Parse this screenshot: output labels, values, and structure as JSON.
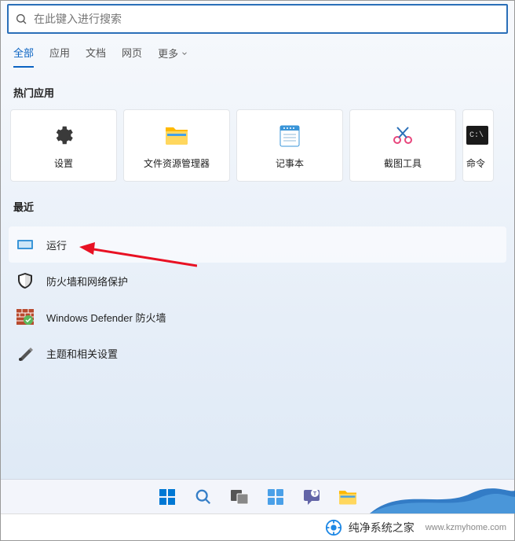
{
  "search": {
    "placeholder": "在此键入进行搜索"
  },
  "tabs": {
    "items": [
      {
        "label": "全部",
        "active": true
      },
      {
        "label": "应用"
      },
      {
        "label": "文档"
      },
      {
        "label": "网页"
      },
      {
        "label": "更多"
      }
    ]
  },
  "top_apps": {
    "title": "热门应用",
    "items": [
      {
        "label": "设置",
        "icon": "settings-icon"
      },
      {
        "label": "文件资源管理器",
        "icon": "file-explorer-icon"
      },
      {
        "label": "记事本",
        "icon": "notepad-icon"
      },
      {
        "label": "截图工具",
        "icon": "snipping-tool-icon"
      },
      {
        "label": "命令",
        "icon": "terminal-icon"
      }
    ]
  },
  "recent": {
    "title": "最近",
    "items": [
      {
        "label": "运行",
        "icon": "run-icon",
        "hover": true
      },
      {
        "label": "防火墙和网络保护",
        "icon": "shield-icon"
      },
      {
        "label": "Windows Defender 防火墙",
        "icon": "firewall-brick-icon"
      },
      {
        "label": "主题和相关设置",
        "icon": "themes-icon"
      }
    ]
  },
  "watermark": {
    "brand": "纯净系统之家",
    "url": "www.kzmyhome.com"
  }
}
